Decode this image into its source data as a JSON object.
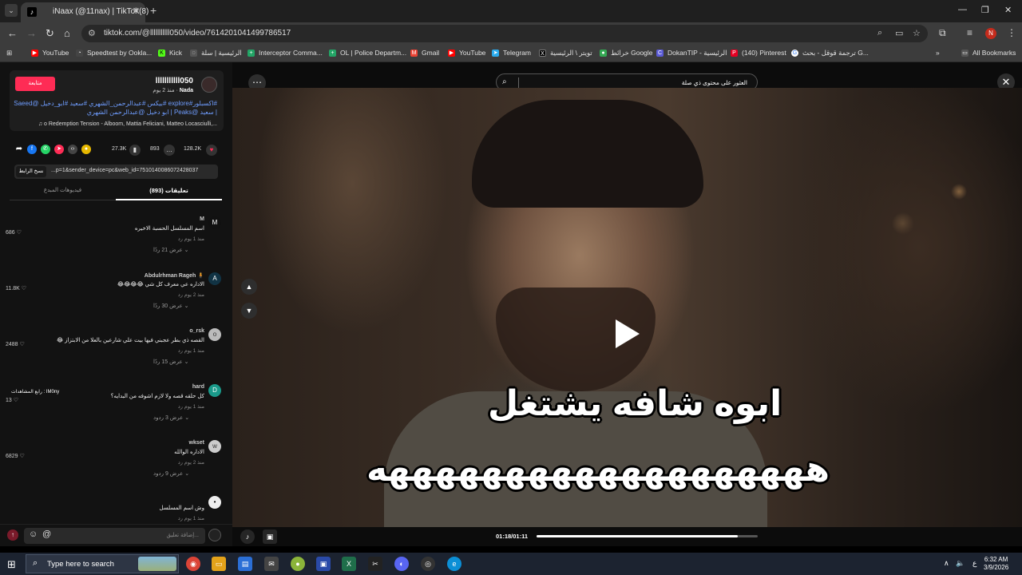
{
  "browser": {
    "tab_title": "iNaax (@11nax) | TikTok(8)",
    "url": "tiktok.com/@lllllllllll050/video/7614201041499786517",
    "bookmarks": [
      {
        "label": "YouTube",
        "icon": "youtube-icon",
        "color": "#ff0000"
      },
      {
        "label": "Speedtest by Ookla...",
        "icon": "speedtest-icon",
        "color": "#ffffff"
      },
      {
        "label": "Kick",
        "icon": "kick-icon",
        "color": "#53fc18"
      },
      {
        "label": "الرئيسية | سلة",
        "icon": "salla-icon",
        "color": "#bbbbbb"
      },
      {
        "label": "Interceptor Comma...",
        "icon": "sheets-icon",
        "color": "#23a566"
      },
      {
        "label": "OL | Police Departm...",
        "icon": "sheets-icon",
        "color": "#23a566"
      },
      {
        "label": "Gmail",
        "icon": "gmail-icon",
        "color": "#ea4335"
      },
      {
        "label": "YouTube",
        "icon": "youtube-icon",
        "color": "#ff0000"
      },
      {
        "label": "Telegram",
        "icon": "telegram-icon",
        "color": "#2aabee"
      },
      {
        "label": "تويتر \\ الرئيسية",
        "icon": "x-icon",
        "color": "#000000"
      },
      {
        "label": "خرائط Google",
        "icon": "maps-icon",
        "color": "#34a853"
      },
      {
        "label": "DokanTIP - الرئيسية",
        "icon": "dokan-icon",
        "color": "#5b5bd6"
      },
      {
        "label": "(140) Pinterest",
        "icon": "pinterest-icon",
        "color": "#e60023"
      },
      {
        "label": "ترجمة قوقل - بحث G...",
        "icon": "google-icon",
        "color": "#ffffff"
      }
    ],
    "all_bookmarks": "All Bookmarks",
    "profile_initial": "N"
  },
  "post": {
    "follow_label": "متابعة",
    "username": "lllllllllll050",
    "nickname": "Nada",
    "time_ago": "منذ 2 يوم",
    "caption": "#اكسبلور#explore #بيكس #عبدالرحمن_الشهري #سعيد #ابو_دخيل @Saeed | سعيد @Peaks | ابو دخيل @عبدالرحمن الشهري",
    "music": "♫ o Redemption Tension - Alboom, Mattia Feliciani, Matteo Locasciulli,...",
    "likes": "128.2K",
    "comments_count": "893",
    "saves": "27.3K",
    "copy_link_label": "نسخ الرابط",
    "link_text": "...p=1&sender_device=pc&web_id=7510140086072428037",
    "tab_comments": "تعليقات (893)",
    "tab_creator": "فيديوهات المبدع"
  },
  "comments": [
    {
      "user": "M",
      "text": "اسم المسلسل الحسبة الاخيره",
      "meta": "منذ 1 يوم   رد",
      "likes": "686 ♡",
      "replies": "عرض 21 ردًا ⌄",
      "avatar": "M"
    },
    {
      "user": "Abdulrhman Rageh 🧍",
      "text": "الاداره عي معرف كل شي 😂😂😂😂",
      "meta": "منذ 2 يوم   رد",
      "likes": "11.8K ♡",
      "replies": "عرض 30 ردًا ⌄",
      "avatar": "A"
    },
    {
      "user": "o_rsk",
      "text": "القصه ذي بطر عجبني فيها بيت علي شارعين بالعلا من الابتزاز 😂",
      "meta": "منذ 1 يوم   رد",
      "likes": "2488 ♡",
      "replies": "عرض 15 ردًا ⌄",
      "avatar": "o"
    },
    {
      "user": "hard",
      "text": "كل حلقه قصه ولا لازم اشوفه من البدايه؟",
      "meta": "منذ 1 يوم   رد",
      "likes": "13 ♡",
      "replies": "عرض 3 ردود ⌄",
      "avatar": "D",
      "badge": "رابع المشاهدات : IM0ny"
    },
    {
      "user": "wkset",
      "text": "الاداره الوالله",
      "meta": "منذ 2 يوم   رد",
      "likes": "6829 ♡",
      "replies": "عرض 9 ردود ⌄",
      "avatar": "w"
    },
    {
      "user": "",
      "text": "وش اسم المسلسل",
      "meta": "منذ 1 يوم   رد",
      "likes": "",
      "replies": "",
      "avatar": "•"
    }
  ],
  "comment_input": {
    "placeholder": "إضافة تعليق..."
  },
  "video": {
    "search_text": "العثور على محتوى ذي صلة",
    "subtitle_line1": "ابوه شافه يشتغل",
    "subtitle_line2": "هههههههههههههههههههه",
    "timecode": "01:18/01:11",
    "progress": 0.91
  },
  "taskbar": {
    "search_placeholder": "Type here to search",
    "time": "6:32 AM",
    "date": "3/9/2026",
    "lang": "ع"
  }
}
